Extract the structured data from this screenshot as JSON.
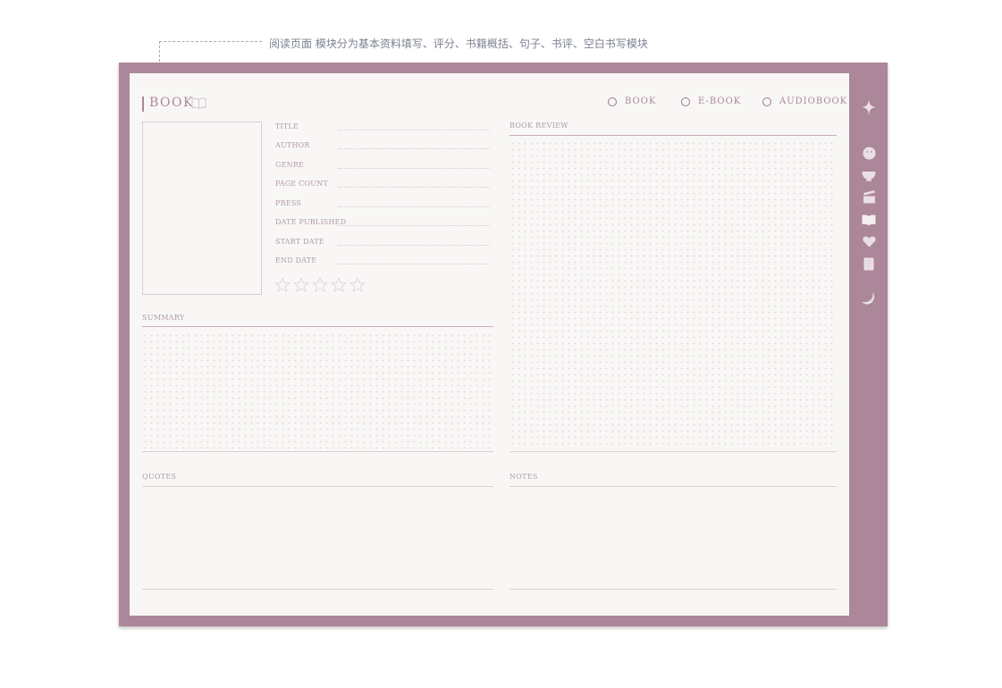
{
  "caption": "阅读页面 模块分为基本资料填写、评分、书籍概括、句子、书评、空白书写模块",
  "header": {
    "title": "BOOK"
  },
  "formats": [
    {
      "label": "BOOK"
    },
    {
      "label": "E-BOOK"
    },
    {
      "label": "AUDIOBOOK"
    }
  ],
  "fields": [
    {
      "label": "TITLE"
    },
    {
      "label": "AUTHOR"
    },
    {
      "label": "GENRE"
    },
    {
      "label": "PAGE COUNT"
    },
    {
      "label": "PRESS"
    },
    {
      "label": "DATE PUBLISHED"
    },
    {
      "label": "START DATE"
    },
    {
      "label": "END DATE"
    }
  ],
  "rating": {
    "value": 0,
    "max": 5
  },
  "sections": {
    "summary": "SUMMARY",
    "review": "BOOK REVIEW",
    "quotes": "QUOTES",
    "notes": "NOTES"
  },
  "sidebar": {
    "icons": [
      "sparkle-icon",
      "smiley-icon",
      "bowl-icon",
      "clapperboard-icon",
      "open-book-icon",
      "heart-icon",
      "note-icon",
      "moon-icon"
    ]
  },
  "colors": {
    "frame": "#ab8799",
    "page": "#f8f7f5",
    "accent_text": "#ab8799",
    "caption_text": "#7d8192"
  }
}
